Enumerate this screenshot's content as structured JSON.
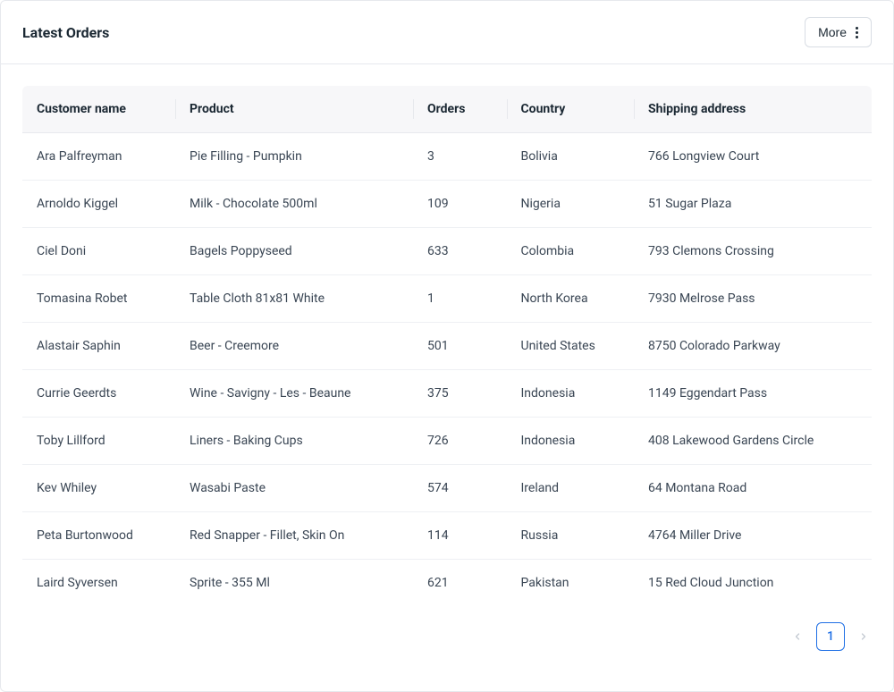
{
  "header": {
    "title": "Latest Orders",
    "more_label": "More"
  },
  "table": {
    "columns": [
      "Customer name",
      "Product",
      "Orders",
      "Country",
      "Shipping address"
    ],
    "rows": [
      {
        "customer": "Ara Palfreyman",
        "product": "Pie Filling - Pumpkin",
        "orders": "3",
        "country": "Bolivia",
        "address": "766 Longview Court"
      },
      {
        "customer": "Arnoldo Kiggel",
        "product": "Milk - Chocolate 500ml",
        "orders": "109",
        "country": "Nigeria",
        "address": "51 Sugar Plaza"
      },
      {
        "customer": "Ciel Doni",
        "product": "Bagels Poppyseed",
        "orders": "633",
        "country": "Colombia",
        "address": "793 Clemons Crossing"
      },
      {
        "customer": "Tomasina Robet",
        "product": "Table Cloth 81x81 White",
        "orders": "1",
        "country": "North Korea",
        "address": "7930 Melrose Pass"
      },
      {
        "customer": "Alastair Saphin",
        "product": "Beer - Creemore",
        "orders": "501",
        "country": "United States",
        "address": "8750 Colorado Parkway"
      },
      {
        "customer": "Currie Geerdts",
        "product": "Wine - Savigny - Les - Beaune",
        "orders": "375",
        "country": "Indonesia",
        "address": "1149 Eggendart Pass"
      },
      {
        "customer": "Toby Lillford",
        "product": "Liners - Baking Cups",
        "orders": "726",
        "country": "Indonesia",
        "address": "408 Lakewood Gardens Circle"
      },
      {
        "customer": "Kev Whiley",
        "product": "Wasabi Paste",
        "orders": "574",
        "country": "Ireland",
        "address": "64 Montana Road"
      },
      {
        "customer": "Peta Burtonwood",
        "product": "Red Snapper - Fillet, Skin On",
        "orders": "114",
        "country": "Russia",
        "address": "4764 Miller Drive"
      },
      {
        "customer": "Laird Syversen",
        "product": "Sprite - 355 Ml",
        "orders": "621",
        "country": "Pakistan",
        "address": "15 Red Cloud Junction"
      }
    ]
  },
  "pagination": {
    "current_page": "1"
  }
}
